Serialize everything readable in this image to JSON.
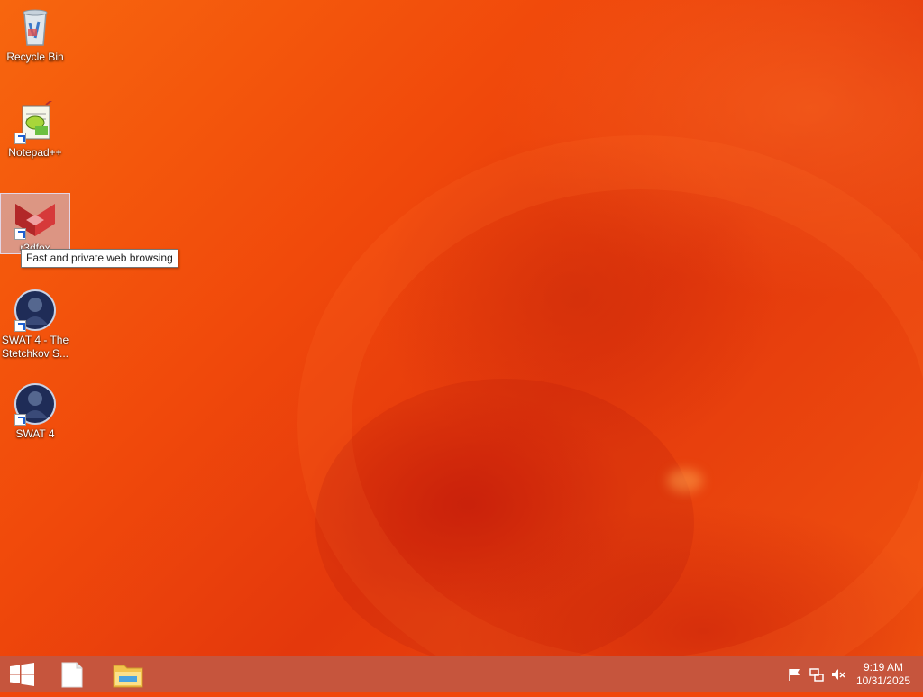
{
  "desktop": {
    "icons": [
      {
        "label": "Recycle Bin",
        "icon": "recycle-bin-icon"
      },
      {
        "label": "Notepad++",
        "icon": "notepad-plus-plus-icon"
      },
      {
        "label": "r3dfox",
        "icon": "r3dfox-icon"
      },
      {
        "label": "SWAT 4 - The Stetchkov S...",
        "icon": "swat4-icon"
      },
      {
        "label": "SWAT 4",
        "icon": "swat4-icon"
      }
    ],
    "tooltip": "Fast and private web browsing"
  },
  "taskbar": {
    "start_icon": "windows-logo-icon",
    "pinned": [
      {
        "icon": "document-icon"
      },
      {
        "icon": "file-explorer-icon"
      }
    ],
    "tray": [
      {
        "icon": "action-center-flag-icon"
      },
      {
        "icon": "network-icon"
      },
      {
        "icon": "volume-muted-icon"
      }
    ],
    "clock": {
      "time": "9:19 AM",
      "date": "10/31/2025"
    }
  },
  "colors": {
    "wallpaper": "#f0460c",
    "taskbar": "#c6553d"
  }
}
